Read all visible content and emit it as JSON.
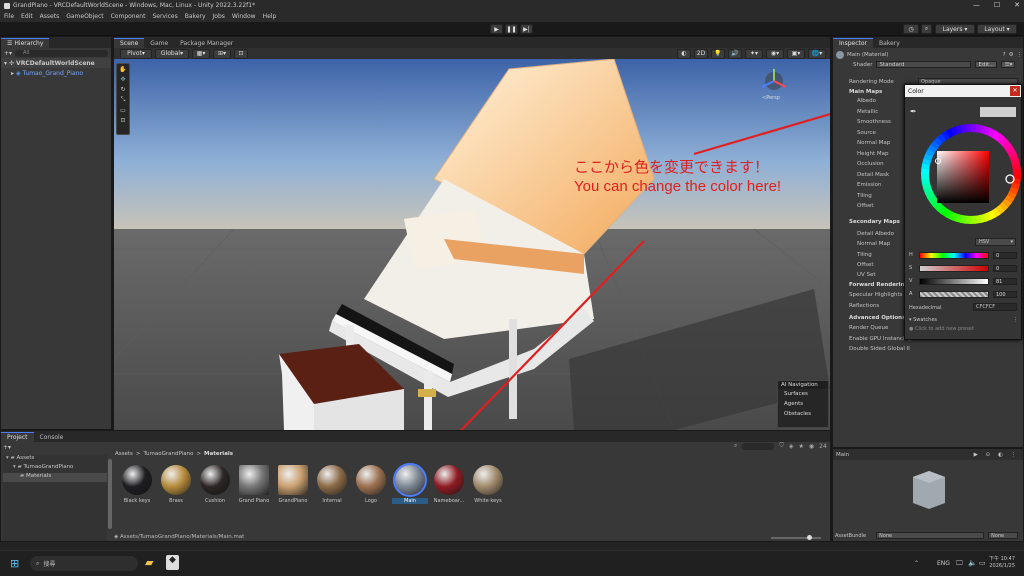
{
  "window": {
    "title": "GrandPiano - VRCDefaultWorldScene - Windows, Mac, Linux - Unity 2022.3.22f1*"
  },
  "menu": [
    "File",
    "Edit",
    "Assets",
    "GameObject",
    "Component",
    "Services",
    "Bakery",
    "Jobs",
    "Window",
    "Help"
  ],
  "toolbar": {
    "layers_label": "Layers",
    "layout_label": "Layout"
  },
  "hierarchy": {
    "tab": "Hierarchy",
    "search_placeholder": "All",
    "scene": "VRCDefaultWorldScene",
    "object": "Tumao_Grand_Piano"
  },
  "scene_view": {
    "tabs": [
      "Scene",
      "Game",
      "Package Manager"
    ],
    "pivot": "Pivot",
    "global": "Global",
    "mode_2d": "2D",
    "gizmo_label": "<Persp",
    "annotation_jp": "ここから色を変更できます！",
    "annotation_en": "You can change the color here!",
    "annotation_color": "#e02020",
    "ai_nav": {
      "title": "AI Navigation",
      "items": [
        "Surfaces",
        "Agents",
        "Obstacles"
      ]
    }
  },
  "inspector": {
    "tabs": [
      "Inspector",
      "Bakery"
    ],
    "material_name": "Main (Material)",
    "shader_label": "Shader",
    "shader_value": "Standard",
    "edit_button": "Edit...",
    "rendering_mode_label": "Rendering Mode",
    "rendering_mode_value": "Opaque",
    "main_maps": "Main Maps",
    "rows": [
      "Albedo",
      "Metallic",
      "Smoothness",
      "Source",
      "Normal Map",
      "Height Map",
      "Occlusion",
      "Detail Mask",
      "Emission",
      "Tiling",
      "Offset"
    ],
    "secondary_maps": "Secondary Maps",
    "rows2": [
      "Detail Albedo",
      "Normal Map",
      "Tiling",
      "Offset",
      "UV Set"
    ],
    "forward": "Forward Rendering",
    "forward_rows": [
      "Specular Highlights",
      "Reflections"
    ],
    "advanced": "Advanced Options",
    "advanced_rows": [
      "Render Queue",
      "Enable GPU Instancing",
      "Double Sided Global Il"
    ]
  },
  "color_picker": {
    "title": "Color",
    "mode": "HSV",
    "channels": [
      {
        "name": "H",
        "value": "0"
      },
      {
        "name": "S",
        "value": "0"
      },
      {
        "name": "V",
        "value": "81"
      },
      {
        "name": "A",
        "value": "100"
      }
    ],
    "hex_label": "Hexadecimal",
    "hex_value": "CFCFCF",
    "swatches_label": "Swatches",
    "swatches_hint": "Click to add new preset",
    "current_color": "#cfcfcf"
  },
  "project": {
    "tabs": [
      "Project",
      "Console"
    ],
    "tree": [
      "Assets",
      "TumaoGrandPiano",
      "Materials"
    ],
    "breadcrumb": [
      "Assets",
      "TumaoGrandPiano",
      "Materials"
    ],
    "count": "24",
    "assets": [
      {
        "name": "Black keys",
        "color": "#1e1e22"
      },
      {
        "name": "Brass",
        "color": "#b58a3c"
      },
      {
        "name": "Cushion",
        "color": "#2c2624"
      },
      {
        "name": "Grand Piano",
        "color": "#777"
      },
      {
        "name": "GrandPiano",
        "color": "#caa070"
      },
      {
        "name": "Internal",
        "color": "#8b6a48"
      },
      {
        "name": "Logo",
        "color": "#9a7050"
      },
      {
        "name": "Main",
        "color": "#7d8894"
      },
      {
        "name": "Nameboar...",
        "color": "#8e1c22"
      },
      {
        "name": "White keys",
        "color": "#a08a6c"
      }
    ],
    "path": "Assets/TumaoGrandPiano/Materials/Main.mat"
  },
  "preview": {
    "title": "Main",
    "asset_bundle_label": "AssetBundle",
    "asset_bundle_value": "None",
    "variant_value": "None"
  },
  "taskbar": {
    "search_placeholder": "搜尋",
    "lang": "ENG",
    "time": "下午 10:47",
    "date": "2026/1/25"
  }
}
